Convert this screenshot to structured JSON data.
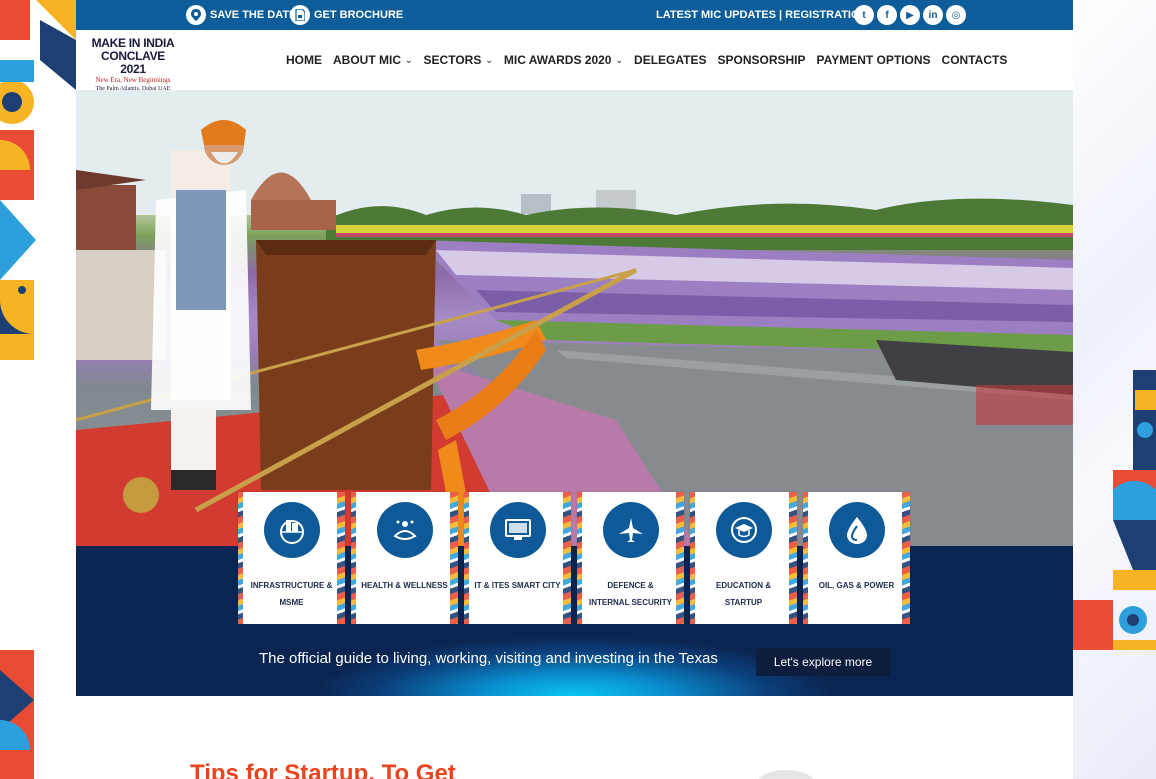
{
  "topbar": {
    "save_dates": "SAVE THE DATES!",
    "brochure": "GET BROCHURE",
    "updates": "LATEST MIC UPDATES | REGISTRATION",
    "social": [
      {
        "name": "twitter-icon",
        "glyph": "t"
      },
      {
        "name": "facebook-icon",
        "glyph": "f"
      },
      {
        "name": "youtube-icon",
        "glyph": "▶"
      },
      {
        "name": "linkedin-icon",
        "glyph": "in"
      },
      {
        "name": "instagram-icon",
        "glyph": "◎"
      }
    ]
  },
  "logo": {
    "line1": "MAKE IN INDIA",
    "line2": "CONCLAVE 2021",
    "line3": "New Era, New Beginnings",
    "line4": "The Palm Atlantis, Dubai UAE"
  },
  "nav": {
    "items": [
      {
        "label": "HOME",
        "dropdown": false
      },
      {
        "label": "ABOUT MIC",
        "dropdown": true
      },
      {
        "label": "SECTORS",
        "dropdown": true
      },
      {
        "label": "MIC AWARDS 2020",
        "dropdown": true
      },
      {
        "label": "DELEGATES",
        "dropdown": false
      },
      {
        "label": "SPONSORSHIP",
        "dropdown": false
      },
      {
        "label": "PAYMENT OPTIONS",
        "dropdown": false
      },
      {
        "label": "CONTACTS",
        "dropdown": false
      }
    ]
  },
  "sectors": [
    {
      "line1": "INFRASTRUCTURE &",
      "line2": "MSME",
      "icon": "city-globe-icon"
    },
    {
      "line1": "HEALTH & WELLNESS",
      "line2": "",
      "icon": "wellness-icon"
    },
    {
      "line1": "IT & ITES SMART CITY",
      "line2": "",
      "icon": "monitor-icon"
    },
    {
      "line1": "DEFENCE &",
      "line2": "INTERNAL SECURITY",
      "icon": "jet-icon"
    },
    {
      "line1": "EDUCATION &",
      "line2": "STARTUP",
      "icon": "graduation-cap-icon"
    },
    {
      "line1": "OIL, GAS & POWER",
      "line2": "",
      "icon": "drop-icon"
    }
  ],
  "band": {
    "tagline": "The official guide to living, working, visiting and investing in the Texas",
    "cta": "Let's explore more"
  },
  "section": {
    "heading": "Tips for Startup, To Get"
  },
  "colors": {
    "brand_blue": "#0c5d99",
    "dark_navy": "#0b2552",
    "accent_orange": "#e8441e"
  }
}
